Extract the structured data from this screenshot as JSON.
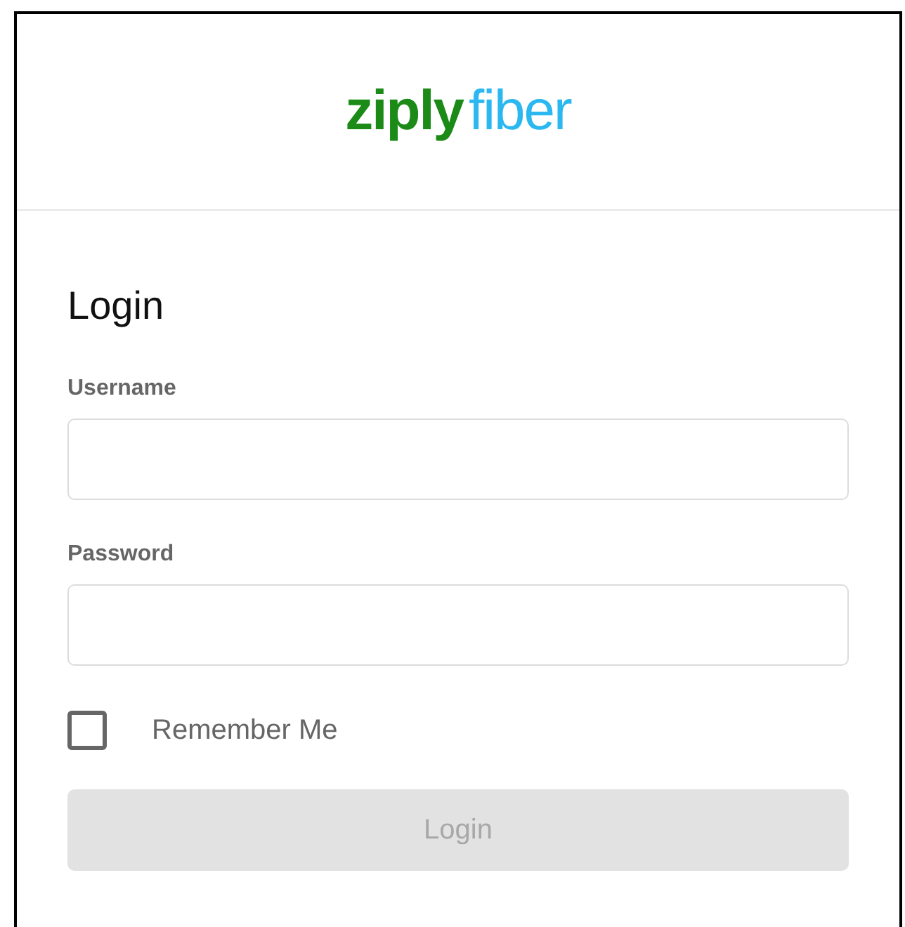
{
  "logo": {
    "part_1": "ziply",
    "part_2": "fiber"
  },
  "title": "Login",
  "fields": [
    {
      "label": "Username"
    },
    {
      "label": "Password"
    }
  ],
  "remember_me": {
    "label": "Remember Me",
    "checked": false
  },
  "login_button": {
    "label": "Login",
    "disabled": true
  }
}
